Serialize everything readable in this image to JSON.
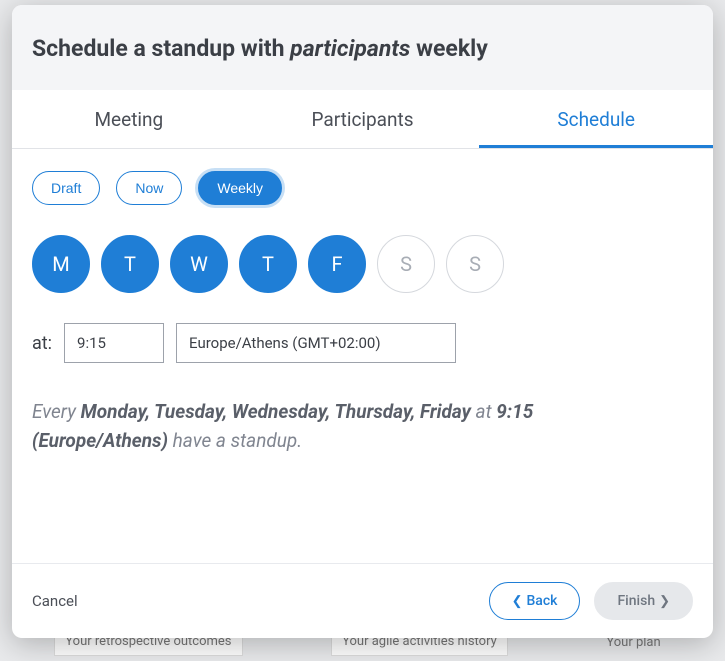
{
  "header": {
    "title_a": "Schedule a standup with ",
    "title_b": "participants",
    "title_c": " weekly"
  },
  "tabs": [
    {
      "label": "Meeting",
      "active": false
    },
    {
      "label": "Participants",
      "active": false
    },
    {
      "label": "Schedule",
      "active": true
    }
  ],
  "mode_pills": [
    {
      "label": "Draft",
      "active": false
    },
    {
      "label": "Now",
      "active": false
    },
    {
      "label": "Weekly",
      "active": true
    }
  ],
  "days": [
    {
      "letter": "M",
      "selected": true
    },
    {
      "letter": "T",
      "selected": true
    },
    {
      "letter": "W",
      "selected": true
    },
    {
      "letter": "T",
      "selected": true
    },
    {
      "letter": "F",
      "selected": true
    },
    {
      "letter": "S",
      "selected": false
    },
    {
      "letter": "S",
      "selected": false
    }
  ],
  "time": {
    "label": "at:",
    "value": "9:15",
    "timezone": "Europe/Athens (GMT+02:00)"
  },
  "summary": {
    "p1": "Every ",
    "p2": "Monday, Tuesday, Wednesday, Thursday, Friday",
    "p3": " at ",
    "p4": "9:15 (Europe/Athens)",
    "p5": " have a standup."
  },
  "footer": {
    "cancel": "Cancel",
    "back": "Back",
    "finish": "Finish"
  },
  "background": {
    "b1": "Your retrospective outcomes",
    "b2": "Your agile activities history",
    "b3": "Your plan"
  }
}
